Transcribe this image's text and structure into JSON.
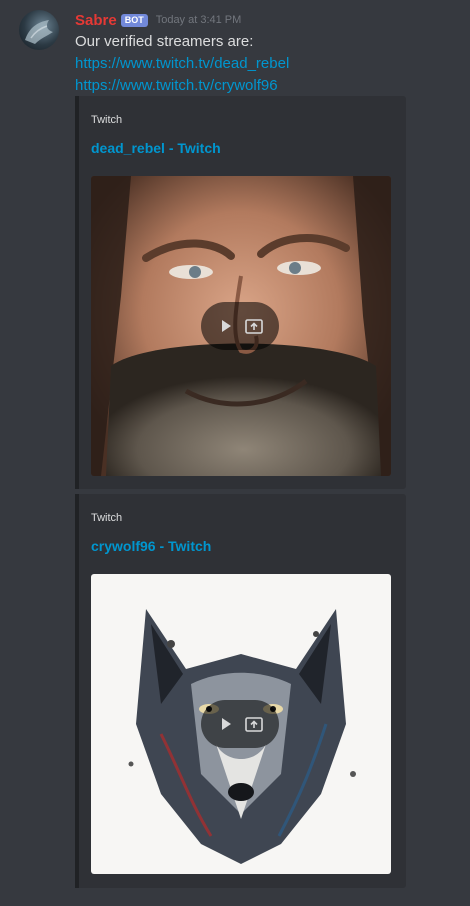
{
  "message": {
    "author": "Sabre",
    "bot_tag": "BOT",
    "timestamp": "Today at 3:41 PM",
    "text": "Our verified streamers are:",
    "links": [
      "https://www.twitch.tv/dead_rebel",
      "https://www.twitch.tv/crywolf96"
    ]
  },
  "embeds": [
    {
      "provider": "Twitch",
      "title": "dead_rebel - Twitch"
    },
    {
      "provider": "Twitch",
      "title": "crywolf96 - Twitch"
    }
  ],
  "colors": {
    "background": "#36393f",
    "embed_background": "#2f3136",
    "username": "#e53935",
    "link": "#0096cf",
    "bot_tag": "#7289da"
  },
  "icons": [
    "play-icon",
    "open-external-icon"
  ]
}
